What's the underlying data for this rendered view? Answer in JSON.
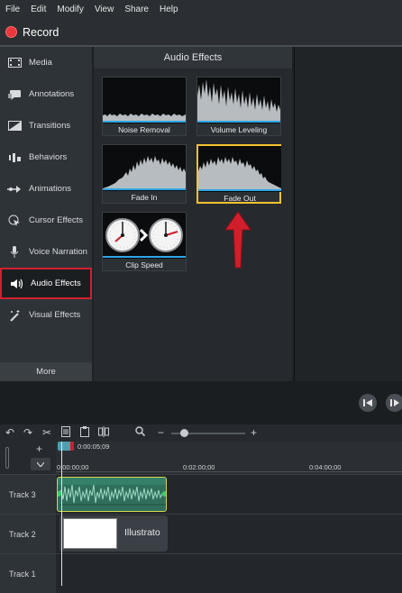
{
  "menu": [
    "File",
    "Edit",
    "Modify",
    "View",
    "Share",
    "Help"
  ],
  "record_label": "Record",
  "sidebar": {
    "items": [
      {
        "label": "Media",
        "icon": "film-strip-icon"
      },
      {
        "label": "Annotations",
        "icon": "annotation-icon"
      },
      {
        "label": "Transitions",
        "icon": "transition-icon"
      },
      {
        "label": "Behaviors",
        "icon": "behaviors-icon"
      },
      {
        "label": "Animations",
        "icon": "animation-arrow-icon"
      },
      {
        "label": "Cursor Effects",
        "icon": "cursor-icon"
      },
      {
        "label": "Voice Narration",
        "icon": "microphone-icon"
      },
      {
        "label": "Audio Effects",
        "icon": "speaker-icon",
        "active": true
      },
      {
        "label": "Visual Effects",
        "icon": "magic-wand-icon"
      }
    ],
    "more_label": "More"
  },
  "panel": {
    "title": "Audio Effects",
    "tiles": [
      {
        "label": "Noise Removal"
      },
      {
        "label": "Volume Leveling"
      },
      {
        "label": "Fade In"
      },
      {
        "label": "Fade Out",
        "selected": true
      },
      {
        "label": "Clip Speed"
      }
    ]
  },
  "timeline": {
    "playhead_time": "0:00:05;09",
    "ruler_labels": [
      "0:00:00;00",
      "0:02:00;00",
      "0:04:00;00"
    ],
    "tracks": [
      "Track 3",
      "Track 2",
      "Track 1"
    ],
    "media_clip_label": "Illustrato"
  },
  "colors": {
    "record_red": "#e8383d",
    "highlight_red": "#d3202e",
    "selected_yellow": "#f2c230",
    "arrow_red": "#d01f2b",
    "audio_clip_green": "#2f6f5c"
  }
}
